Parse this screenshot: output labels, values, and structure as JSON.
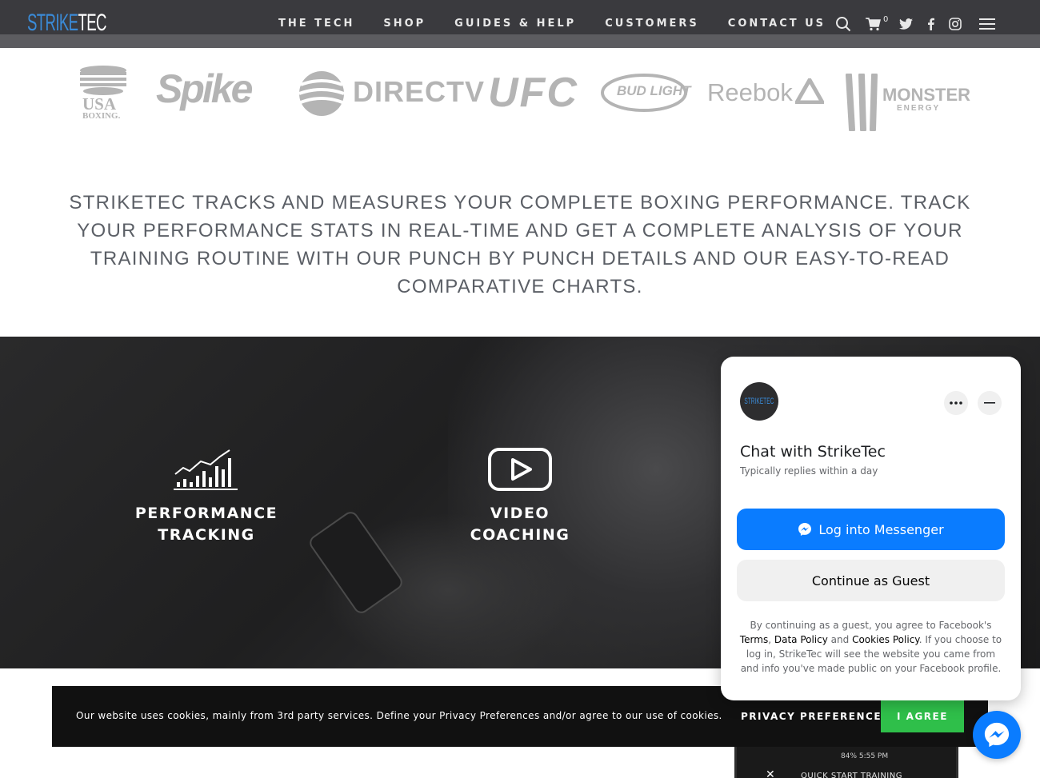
{
  "header": {
    "logo_strike": "STRIKE",
    "logo_tec": "TEC",
    "nav": [
      "THE TECH",
      "SHOP",
      "GUIDES & HELP",
      "CUSTOMERS",
      "CONTACT US"
    ],
    "cart_count": "0",
    "icons": [
      "search-icon",
      "cart-icon",
      "twitter-icon",
      "facebook-icon",
      "instagram-icon",
      "menu-icon"
    ]
  },
  "partners": {
    "usa_boxing_top": "USA",
    "usa_boxing_bottom": "BOXING.",
    "spike": "Spike",
    "directv": "DIRECTV",
    "ufc": "UFC",
    "bud_light": "BUD LIGHT",
    "reebok": "Reebok",
    "monster": "MONSTER",
    "monster_sub": "ENERGY"
  },
  "statement": "STRIKETEC TRACKS AND MEASURES YOUR COMPLETE BOXING PERFORMANCE. TRACK YOUR PERFORMANCE STATS IN REAL-TIME AND GET A COMPLETE ANALYSIS OF YOUR TRAINING ROUTINE WITH OUR PUNCH BY PUNCH DETAILS AND OUR EASY-TO-READ COMPARATIVE CHARTS.",
  "features": [
    {
      "line1": "PERFORMANCE",
      "line2": "TRACKING",
      "icon": "bar-chart-icon"
    },
    {
      "line1": "VIDEO",
      "line2": "COACHING",
      "icon": "play-icon"
    }
  ],
  "cookie": {
    "text": "Our website uses cookies, mainly from 3rd party services. Define your Privacy Preferences and/or agree to our use of cookies.",
    "privacy_label": "PRIVACY PREFERENCES",
    "agree_label": "I AGREE",
    "agree_color": "#2fbf4a"
  },
  "phone_preview": {
    "status": "84% 5:55 PM",
    "screen_title": "QUICK START TRAINING"
  },
  "chat": {
    "avatar_text": "STRIKETEC",
    "title": "Chat with StrikeTec",
    "subtitle": "Typically replies within a day",
    "messenger_label": "Log into Messenger",
    "guest_label": "Continue as Guest",
    "legal_prefix": "By continuing as a guest, you agree to Facebook's",
    "terms": "Terms",
    "sep1": ",",
    "data_policy": "Data Policy",
    "and": "and",
    "cookies_policy": "Cookies Policy",
    "legal_suffix": ". If you choose to log in, StrikeTec will see the website you came from and info you've made public on your Facebook profile.",
    "accent": "#0a7cff"
  }
}
